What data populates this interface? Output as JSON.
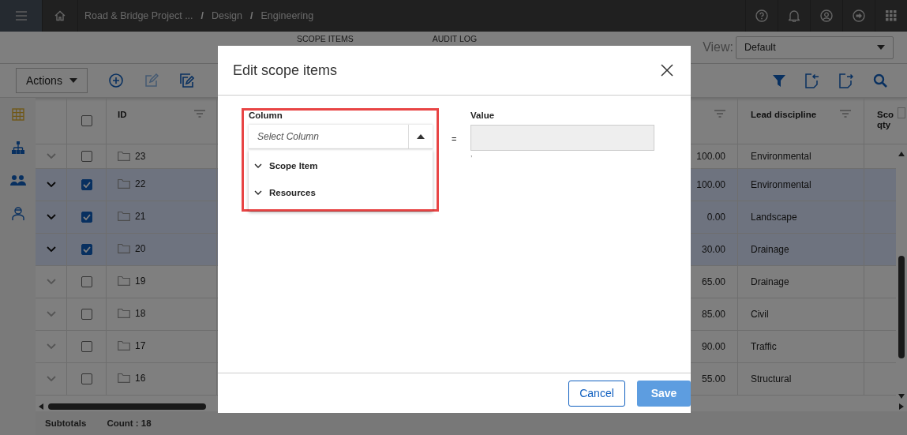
{
  "breadcrumb": [
    {
      "kind": "link",
      "text": "Road & Bridge Project ..."
    },
    {
      "kind": "separator",
      "text": "/"
    },
    {
      "kind": "link",
      "text": "Design"
    },
    {
      "kind": "separator",
      "text": "/"
    },
    {
      "kind": "link",
      "text": "Engineering"
    }
  ],
  "tabs": [
    {
      "label": "SCOPE ITEMS"
    },
    {
      "label": "AUDIT LOG"
    }
  ],
  "view": {
    "label": "View:",
    "value": "Default"
  },
  "toolbar": {
    "actions": "Actions"
  },
  "grid": {
    "all_selected": false,
    "columns": [
      {
        "label": "ID"
      },
      {
        "label": "Lead discipline"
      },
      {
        "label": "Sco qty"
      }
    ],
    "rows": [
      {
        "id": "23",
        "selected": false,
        "amount": "100.00",
        "lead": "Environmental"
      },
      {
        "id": "22",
        "selected": true,
        "amount": "100.00",
        "lead": "Environmental"
      },
      {
        "id": "21",
        "selected": true,
        "amount": "0.00",
        "lead": "Landscape"
      },
      {
        "id": "20",
        "selected": true,
        "amount": "30.00",
        "lead": "Drainage"
      },
      {
        "id": "19",
        "selected": false,
        "amount": "65.00",
        "lead": "Drainage"
      },
      {
        "id": "18",
        "selected": false,
        "amount": "85.00",
        "lead": "Civil"
      },
      {
        "id": "17",
        "selected": false,
        "amount": "90.00",
        "lead": "Traffic"
      },
      {
        "id": "16",
        "selected": false,
        "amount": "55.00",
        "lead": "Structural"
      }
    ],
    "subtotals": {
      "label": "Subtotals",
      "count": "Count : 18"
    }
  },
  "modal": {
    "title": "Edit scope items",
    "column_label": "Column",
    "placeholder": "Select Column",
    "options": [
      {
        "label": "Scope Item"
      },
      {
        "label": "Resources"
      }
    ],
    "operator": "=",
    "value_label": "Value",
    "value_note": ",",
    "buttons": [
      {
        "label": "Cancel",
        "kind": "secondary"
      },
      {
        "label": "Save",
        "kind": "primary"
      }
    ]
  }
}
